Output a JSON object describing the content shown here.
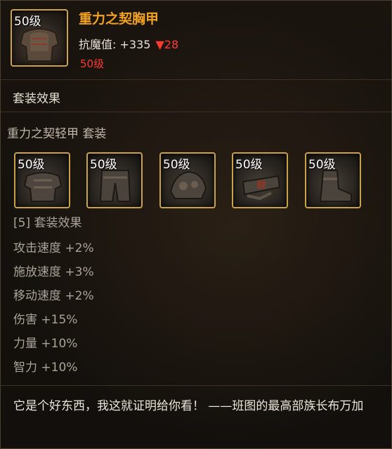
{
  "item": {
    "level_badge": "50级",
    "name": "重力之契胸甲",
    "stat_label": "抗魔值:",
    "stat_value": "+335",
    "stat_change": "▼28",
    "required_level": "50级"
  },
  "set": {
    "section_title": "套装效果",
    "set_name": "重力之契轻甲 套装",
    "pieces": [
      {
        "level": "50级",
        "icon": "chest-armor-icon"
      },
      {
        "level": "50级",
        "icon": "pants-armor-icon"
      },
      {
        "level": "50级",
        "icon": "shoulder-armor-icon"
      },
      {
        "level": "50级",
        "icon": "belt-armor-icon"
      },
      {
        "level": "50级",
        "icon": "boots-armor-icon"
      }
    ],
    "bonus_header": "[5] 套装效果",
    "bonuses": [
      "攻击速度 +2%",
      "施放速度 +3%",
      "移动速度 +2%",
      "伤害 +15%",
      "力量 +10%",
      "智力 +10%"
    ]
  },
  "flavor_text": "它是个好东西，我这就证明给你看！ ——班图的最高部族长布万加",
  "colors": {
    "item_name": "#f3a21f",
    "stat_down": "#ff3b30",
    "required_level": "#ff3b2f",
    "frame_gold": "#c9a24a"
  }
}
